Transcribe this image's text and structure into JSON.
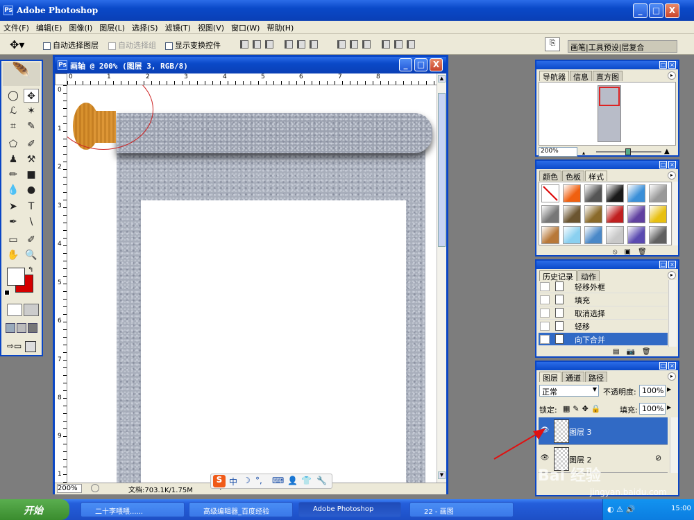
{
  "app": {
    "title": "Adobe Photoshop",
    "logo": "Ps",
    "controls": {
      "minimize": "_",
      "maximize": "□",
      "close": "X"
    }
  },
  "menu": [
    "文件(F)",
    "编辑(E)",
    "图像(I)",
    "图层(L)",
    "选择(S)",
    "滤镜(T)",
    "视图(V)",
    "窗口(W)",
    "帮助(H)"
  ],
  "options": {
    "move_icon": "move-tool-icon",
    "auto_select_layer": "自动选择图层",
    "auto_select_group": "自动选择组",
    "show_transform": "显示变换控件",
    "right_tabs": [
      "画笔",
      "工具预设",
      "层复合"
    ]
  },
  "toolbox": {
    "tools": [
      "◯",
      "✥",
      "ℒ",
      "✶",
      "⌗",
      "✎",
      "⬠",
      "✐",
      "♟",
      "⚒",
      "✏",
      "■",
      "💧",
      "●",
      "➤",
      "T",
      "✒",
      "\\",
      "▭",
      "✐",
      "✋",
      "🔍"
    ],
    "fg_color": "#ffffff",
    "bg_color": "#d40000"
  },
  "document": {
    "title": "画轴 @ 200% (图层 3, RGB/8)",
    "ruler_h": [
      "0",
      "1",
      "2",
      "3",
      "4",
      "5",
      "6",
      "7",
      "8"
    ],
    "ruler_v": [
      "0",
      "1",
      "2",
      "3",
      "4",
      "5",
      "6",
      "7",
      "8",
      "9",
      "1"
    ],
    "zoom": "200%",
    "doc_size": "文档:703.1K/1.75M",
    "ime": {
      "logo": "S",
      "mode": "中",
      "moon": "☽",
      "punct": "°,",
      "kb": "⌨",
      "user": "👤",
      "shirt": "👕",
      "tool": "🔧"
    }
  },
  "navigator": {
    "tabs": [
      "导航器",
      "信息",
      "直方图"
    ],
    "zoom": "200%"
  },
  "styles": {
    "tabs": [
      "颜色",
      "色板",
      "样式"
    ],
    "swatch_colors": [
      "#ffffff",
      "#f06010",
      "#555555",
      "#1a1a1a",
      "#3a8fd8",
      "#999999",
      "#777777",
      "#6b5530",
      "#8a6a2a",
      "#c02020",
      "#6040a0",
      "#e8c010",
      "#b87838",
      "#8ad0f0",
      "#4a88c8",
      "#c8c8c8",
      "#5a4ab0",
      "#606060"
    ]
  },
  "history": {
    "tabs": [
      "历史记录",
      "动作"
    ],
    "items": [
      "轻移外框",
      "填充",
      "取消选择",
      "轻移",
      "向下合并"
    ]
  },
  "layers": {
    "tabs": [
      "图层",
      "通道",
      "路径"
    ],
    "blend_mode": "正常",
    "opacity_label": "不透明度:",
    "opacity": "100%",
    "lock_label": "锁定:",
    "fill_label": "填充:",
    "fill": "100%",
    "items": [
      "图层 3",
      "图层 2"
    ]
  },
  "taskbar": {
    "start": "开始",
    "tasks": [
      "二十李喂喂......",
      "高级编辑器_百度经验",
      "Adobe Photoshop",
      "22 - 画图"
    ],
    "clock": "15:00"
  },
  "watermark": {
    "line1": "Bai 经验",
    "line2": "jingyan.baidu.com"
  }
}
